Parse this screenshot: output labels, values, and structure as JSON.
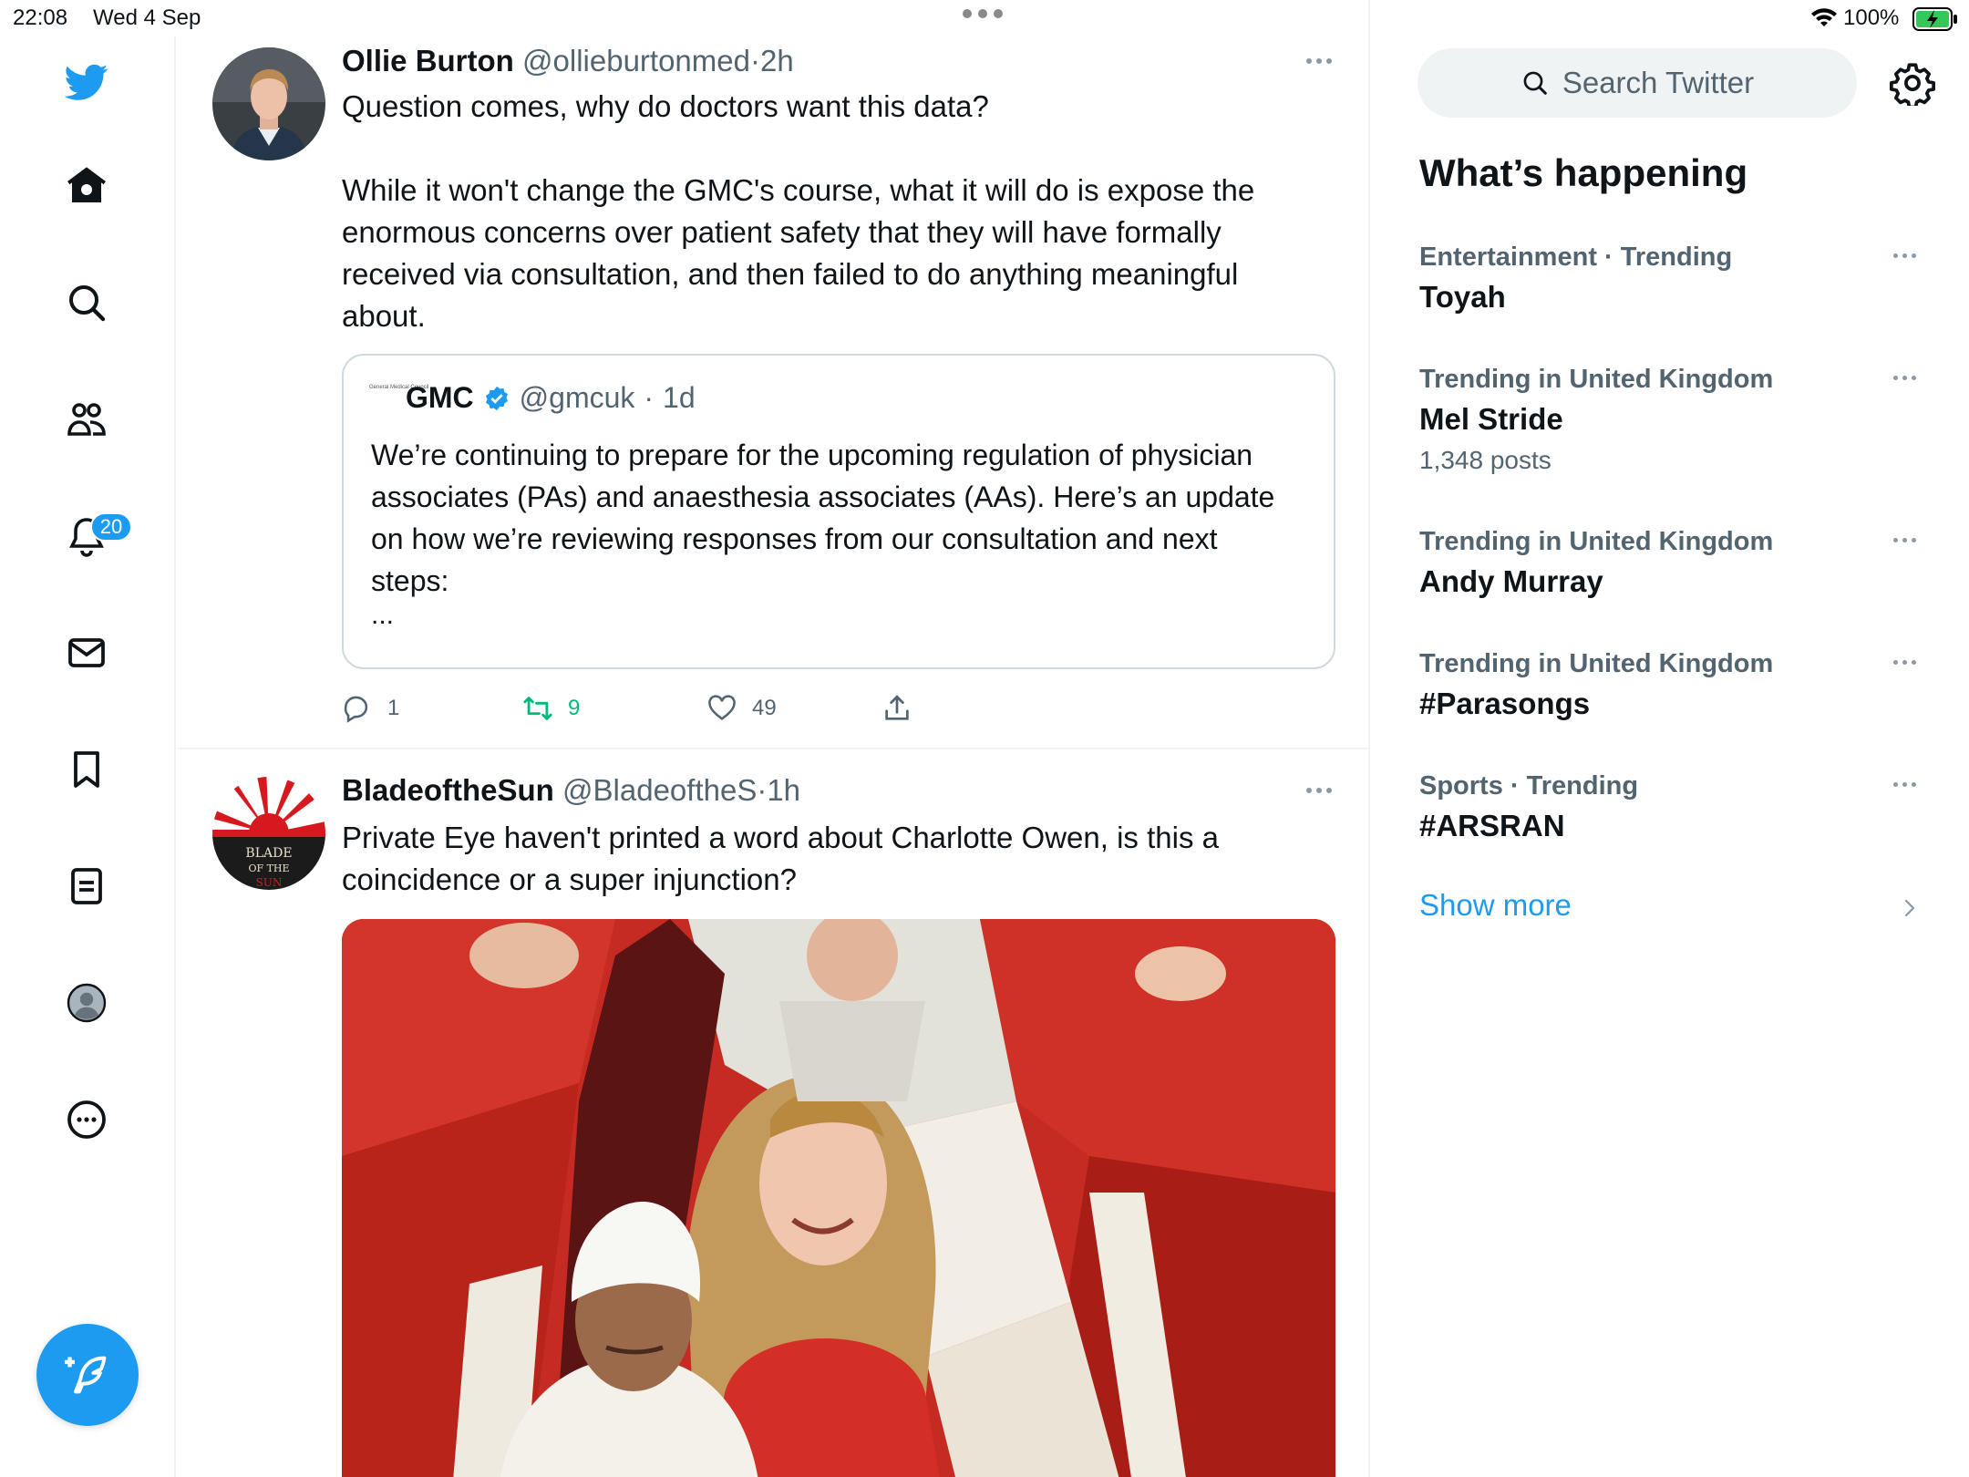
{
  "status_bar": {
    "time": "22:08",
    "date": "Wed 4 Sep",
    "battery": "100%"
  },
  "nav": {
    "notifications_badge": "20",
    "items": [
      "home",
      "explore",
      "communities",
      "notifications",
      "messages",
      "bookmarks",
      "lists",
      "profile",
      "more"
    ]
  },
  "tweets": [
    {
      "name": "Ollie Burton",
      "handle": "@ollieburtonmed",
      "sep": "·",
      "time": "2h",
      "text": "Question comes, why do doctors want this data?\n\nWhile it won't change the GMC's course, what it will do is expose the enormous concerns over patient safety that they will have formally received via consultation, and then failed to do anything meaningful about.",
      "quote": {
        "logo_text": "General Medical Council",
        "name": "GMC",
        "handle": "@gmcuk",
        "sep": "·",
        "time": "1d",
        "text": "We’re continuing to prepare for the upcoming regulation of physician associates (PAs) and anaesthesia associates (AAs). Here’s an update on how we’re reviewing responses from our consultation and next steps:",
        "ellipsis": "..."
      },
      "replies": "1",
      "retweets": "9",
      "likes": "49"
    },
    {
      "name": "BladeoftheSun",
      "handle": "@BladeoftheS",
      "sep": "·",
      "time": "1h",
      "text": "Private Eye haven't printed a word about Charlotte Owen, is this a coincidence or a super injunction?",
      "avatar_text": "BLADE OF THE SUN"
    }
  ],
  "sidebar": {
    "search_placeholder": "Search Twitter",
    "whats_happening": "What’s happening",
    "trends": [
      {
        "context": "Entertainment · Trending",
        "title": "Toyah",
        "count": ""
      },
      {
        "context": "Trending in United Kingdom",
        "title": "Mel Stride",
        "count": "1,348 posts"
      },
      {
        "context": "Trending in United Kingdom",
        "title": "Andy Murray",
        "count": ""
      },
      {
        "context": "Trending in United Kingdom",
        "title": "#Parasongs",
        "count": ""
      },
      {
        "context": "Sports · Trending",
        "title": "#ARSRAN",
        "count": ""
      }
    ],
    "show_more": "Show more"
  },
  "colors": {
    "accent": "#1d9bf0",
    "retweet_active": "#00ba7c",
    "text_primary": "#0f1419",
    "text_secondary": "#536471"
  }
}
